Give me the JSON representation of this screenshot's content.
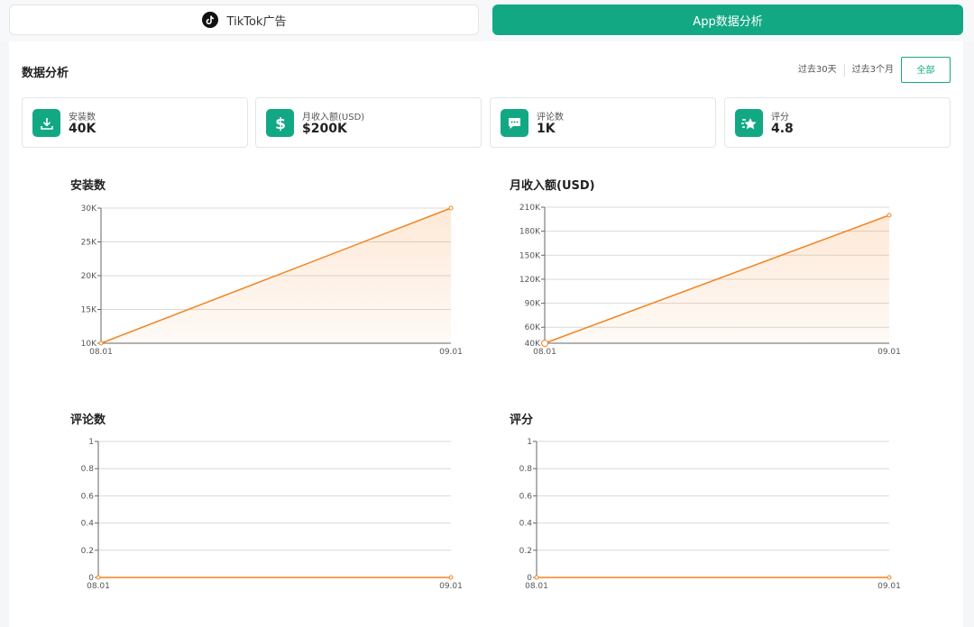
{
  "tabs": {
    "tiktok_label": "TikTok广告",
    "app_label": "App数据分析"
  },
  "section_title": "数据分析",
  "filters": [
    "过去30天",
    "过去3个月",
    "全部"
  ],
  "stats": [
    {
      "label": "安装数",
      "value": "40K",
      "icon": "download-icon"
    },
    {
      "label": "月收入额(USD)",
      "value": "$200K",
      "icon": "dollar-icon"
    },
    {
      "label": "评论数",
      "value": "1K",
      "icon": "comment-icon"
    },
    {
      "label": "评分",
      "value": "4.8",
      "icon": "star-icon"
    }
  ],
  "colors": {
    "accent": "#13a884",
    "line": "#f5831f"
  },
  "chart_data": [
    {
      "type": "area",
      "title": "安装数",
      "x": [
        "08.01",
        "09.01"
      ],
      "y": [
        10000,
        30000
      ],
      "yticks": [
        10000,
        15000,
        20000,
        25000,
        30000
      ],
      "ytick_labels": [
        "10K",
        "15K",
        "20K",
        "25K",
        "30K"
      ],
      "ylim": [
        10000,
        30000
      ],
      "grid": true
    },
    {
      "type": "area",
      "title": "月收入额(USD)",
      "x": [
        "08.01",
        "09.01"
      ],
      "y": [
        40000,
        200000
      ],
      "yticks": [
        40000,
        60000,
        90000,
        120000,
        150000,
        180000,
        210000
      ],
      "ytick_labels": [
        "40K",
        "60K",
        "90K",
        "120K",
        "150K",
        "180K",
        "210K"
      ],
      "ylim": [
        40000,
        210000
      ],
      "grid": true
    },
    {
      "type": "line",
      "title": "评论数",
      "x": [
        "08.01",
        "09.01"
      ],
      "y": [
        0,
        0
      ],
      "yticks": [
        0,
        0.2,
        0.4,
        0.6,
        0.8,
        1
      ],
      "ytick_labels": [
        "0",
        "0.2",
        "0.4",
        "0.6",
        "0.8",
        "1"
      ],
      "ylim": [
        0,
        1
      ],
      "grid": true
    },
    {
      "type": "line",
      "title": "评分",
      "x": [
        "08.01",
        "09.01"
      ],
      "y": [
        0,
        0
      ],
      "yticks": [
        0,
        0.2,
        0.4,
        0.6,
        0.8,
        1
      ],
      "ytick_labels": [
        "0",
        "0.2",
        "0.4",
        "0.6",
        "0.8",
        "1"
      ],
      "ylim": [
        0,
        1
      ],
      "grid": true
    }
  ]
}
